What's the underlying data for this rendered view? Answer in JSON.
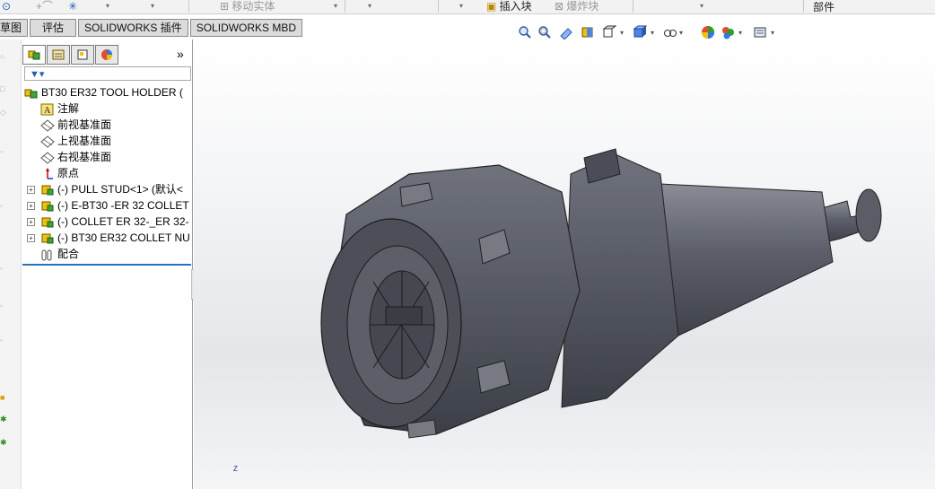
{
  "ribbon": {
    "move_entity": "移动实体",
    "insert_block": "插入块",
    "explode_block": "爆炸块",
    "component": "部件"
  },
  "tabs": [
    {
      "label": "草图"
    },
    {
      "label": "评估"
    },
    {
      "label": "SOLIDWORKS 插件"
    },
    {
      "label": "SOLIDWORKS MBD"
    }
  ],
  "feature_manager": {
    "more": "»",
    "tree": [
      {
        "label": "BT30 ER32 TOOL HOLDER  (",
        "icon": "assembly-icon"
      },
      {
        "label": "注解",
        "icon": "annotation-icon"
      },
      {
        "label": "前视基准面",
        "icon": "plane-icon"
      },
      {
        "label": "上视基准面",
        "icon": "plane-icon"
      },
      {
        "label": "右视基准面",
        "icon": "plane-icon"
      },
      {
        "label": "原点",
        "icon": "origin-icon"
      },
      {
        "label": "(-) PULL STUD<1> (默认<",
        "icon": "part-icon"
      },
      {
        "label": "(-) E-BT30 -ER 32 COLLET",
        "icon": "part-icon"
      },
      {
        "label": "(-) COLLET ER 32-_ER 32-",
        "icon": "part-icon"
      },
      {
        "label": "(-) BT30 ER32 COLLET NU",
        "icon": "part-icon"
      },
      {
        "label": "配合",
        "icon": "mates-icon"
      }
    ]
  },
  "viewport": {
    "axis_label": "Z"
  }
}
